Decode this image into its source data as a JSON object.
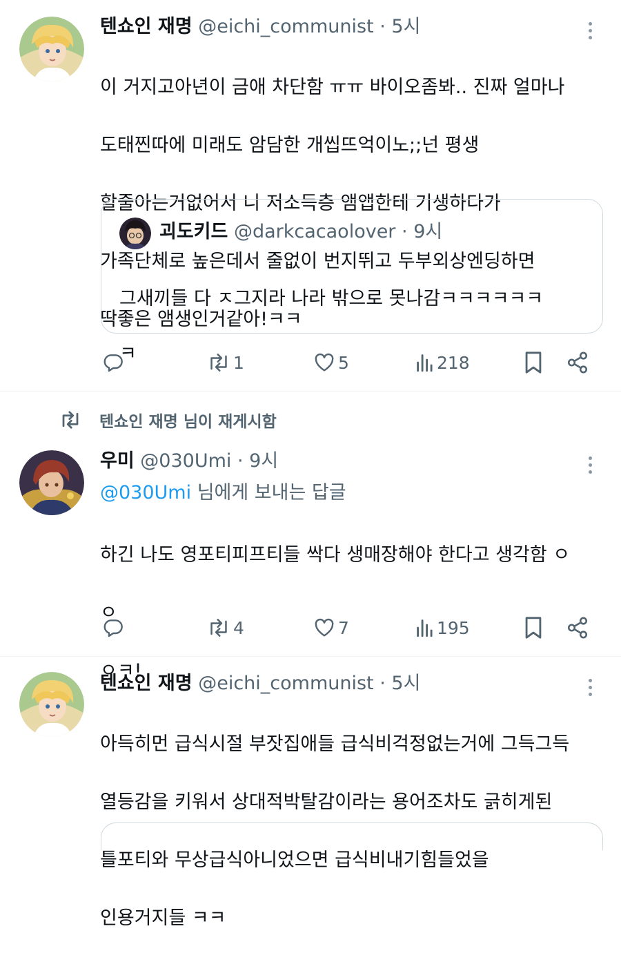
{
  "tweets": [
    {
      "author": {
        "name": "텐쇼인 재명",
        "handle": "@eichi_communist",
        "time": "5시"
      },
      "lines": [
        "이 거지고아년이 금애 차단함 ㅠㅠ 바이오좀봐.. 진짜 얼마나",
        "도태찐따에 미래도 암담한 개씹뜨억이노;;넌 평생",
        "할줄아는거없어서 니 저소득층 앰앱한테 기생하다가",
        "가족단체로 높은데서 줄없이 번지뛰고 두부외상엔딩하면",
        "딱좋은 앰생인거같아!ㅋㅋ"
      ],
      "quote": {
        "author": {
          "name": "괴도키드",
          "handle": "@darkcacaolover",
          "time": "9시"
        },
        "lines": [
          "그새끼들 다 ㅈ그지라 나라 밖으로 못나감ㅋㅋㅋㅋㅋㅋ",
          "ㅋ"
        ]
      },
      "stats": {
        "retweets": "1",
        "likes": "5",
        "views": "218"
      }
    },
    {
      "retweet_banner": "텐쇼인 재명 님이 재게시함",
      "author": {
        "name": "우미",
        "handle": "@030Umi",
        "time": "9시"
      },
      "reply_to": {
        "mention": "@030Umi",
        "suffix": " 님에게 보내는 답글"
      },
      "lines": [
        "하긴 나도 영포티피프티들 싹다 생매장해야 한다고 생각함 ㅇ",
        "ㅇ",
        "ㅇㅋ!"
      ],
      "stats": {
        "retweets": "4",
        "likes": "7",
        "views": "195"
      }
    },
    {
      "author": {
        "name": "텐쇼인 재명",
        "handle": "@eichi_communist",
        "time": "5시"
      },
      "lines": [
        "아득히먼 급식시절 부잣집애들 급식비걱정없는거에 그득그득",
        "열등감을 키워서 상대적박탈감이라는 용어조차도 긁히게된",
        "틀포티와 무상급식아니었으면 급식비내기힘들었을",
        "인용거지들 ㅋㅋ"
      ]
    }
  ],
  "separator_dot": "·",
  "colors": {
    "text": "#0f1419",
    "secondary": "#536471",
    "accent": "#1d9bf0",
    "border": "#cfd9de"
  },
  "icons": [
    "reply-icon",
    "retweet-icon",
    "like-icon",
    "views-icon",
    "bookmark-icon",
    "share-icon",
    "more-icon"
  ]
}
